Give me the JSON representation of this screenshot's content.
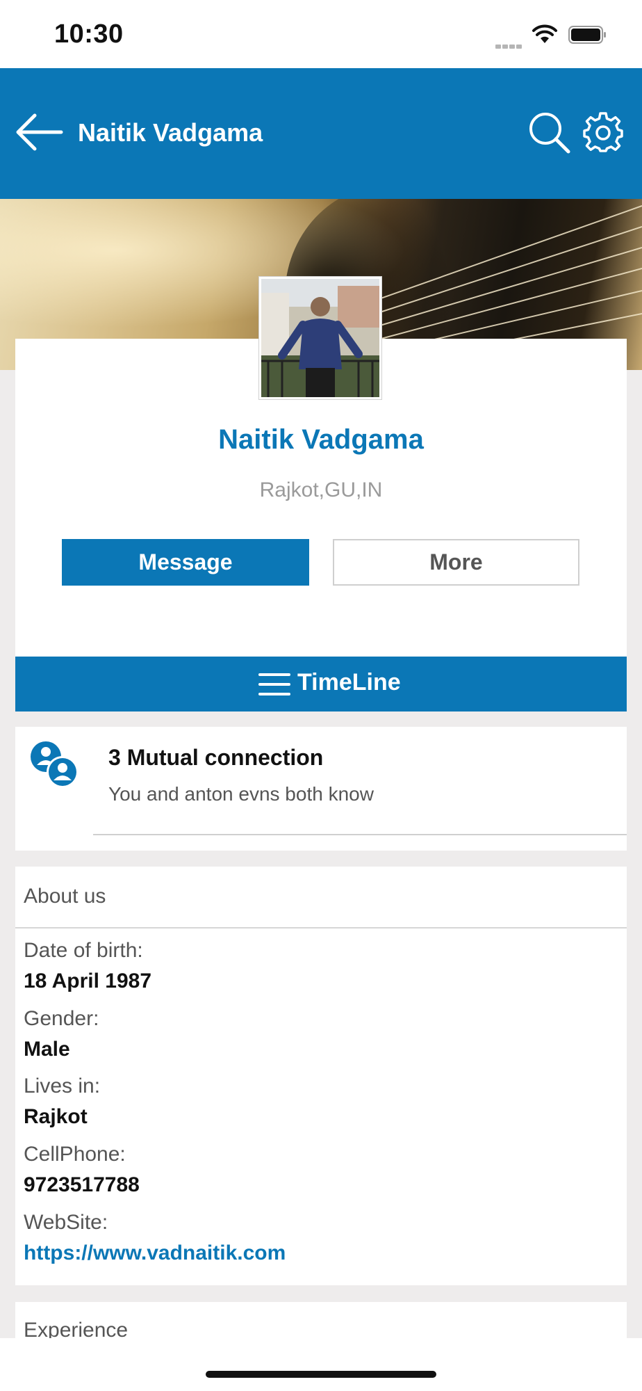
{
  "status_bar": {
    "time": "10:30",
    "icons": [
      "cellular-signal-icon",
      "wifi-icon",
      "battery-icon"
    ]
  },
  "header": {
    "title": "Naitik Vadgama",
    "back_icon": "arrow-left-icon",
    "search_icon": "search-icon",
    "settings_icon": "gear-icon",
    "background_color": "#0b77b6"
  },
  "profile": {
    "name": "Naitik Vadgama",
    "location": "Rajkot,GU,IN",
    "message_label": "Message",
    "more_label": "More"
  },
  "timeline": {
    "label": "TimeLine",
    "icon": "menu-icon"
  },
  "mutual": {
    "title": "3 Mutual connection",
    "subtitle": "You and anton evns both know",
    "icon": "users-icon"
  },
  "about": {
    "title": "About us",
    "fields": [
      {
        "label": "Date of birth:",
        "value": "18 April 1987"
      },
      {
        "label": "Gender:",
        "value": "Male"
      },
      {
        "label": "Lives in:",
        "value": "Rajkot"
      },
      {
        "label": "CellPhone:",
        "value": "9723517788"
      },
      {
        "label": "WebSite:",
        "value": "https://www.vadnaitik.com"
      }
    ]
  },
  "experience": {
    "title": "Experience"
  },
  "colors": {
    "brand": "#0b77b6",
    "page_background": "#eeecec"
  }
}
